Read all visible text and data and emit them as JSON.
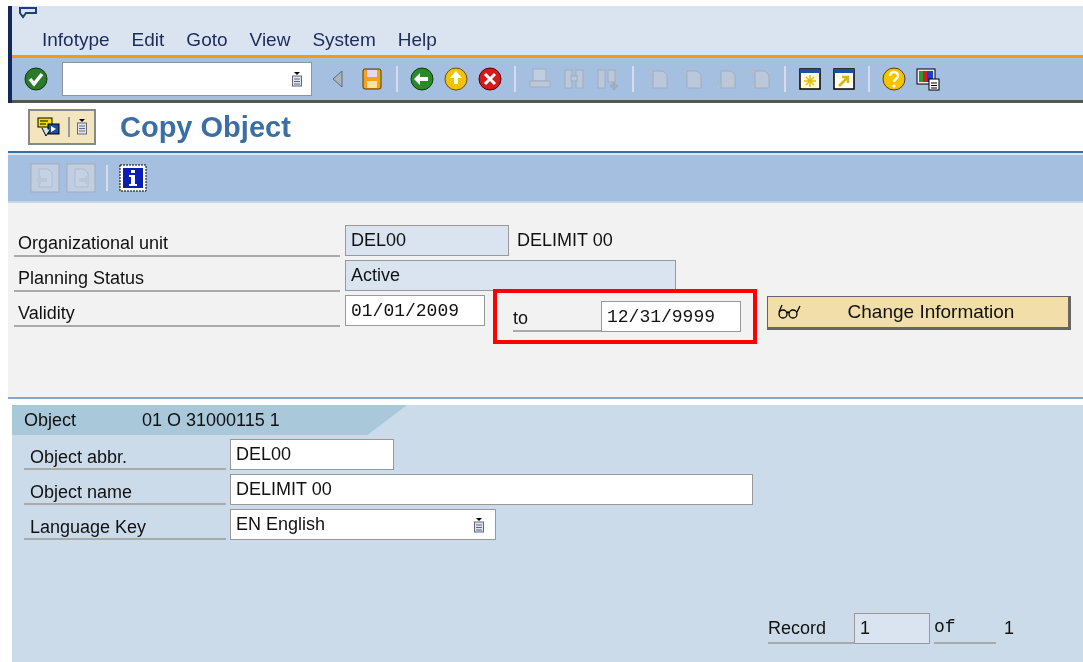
{
  "menu_bar": {
    "items": [
      {
        "label": "Infotype"
      },
      {
        "label": "Edit"
      },
      {
        "label": "Goto"
      },
      {
        "label": "View"
      },
      {
        "label": "System"
      },
      {
        "label": "Help"
      }
    ]
  },
  "standard_toolbar": {
    "items": [
      {
        "kind": "enter",
        "disabled": false
      },
      {
        "kind": "command"
      },
      {
        "kind": "collapse",
        "disabled": false
      },
      {
        "kind": "save",
        "disabled": false
      },
      {
        "kind": "sep"
      },
      {
        "kind": "back",
        "disabled": false
      },
      {
        "kind": "exit",
        "disabled": false
      },
      {
        "kind": "cancel",
        "disabled": false
      },
      {
        "kind": "sep"
      },
      {
        "kind": "print",
        "disabled": true
      },
      {
        "kind": "find",
        "disabled": true
      },
      {
        "kind": "find-next",
        "disabled": true
      },
      {
        "kind": "sep"
      },
      {
        "kind": "first-page",
        "disabled": true
      },
      {
        "kind": "previous-page",
        "disabled": true
      },
      {
        "kind": "next-page",
        "disabled": true
      },
      {
        "kind": "last-page",
        "disabled": true
      },
      {
        "kind": "sep"
      },
      {
        "kind": "new-session",
        "disabled": false
      },
      {
        "kind": "shortcut",
        "disabled": false
      },
      {
        "kind": "sep"
      },
      {
        "kind": "help",
        "disabled": false
      },
      {
        "kind": "layout",
        "disabled": false
      }
    ]
  },
  "title": "Copy Object",
  "app_toolbar": {
    "items": [
      {
        "kind": "previous",
        "disabled": true
      },
      {
        "kind": "next",
        "disabled": true
      },
      {
        "kind": "sep"
      },
      {
        "kind": "info",
        "disabled": false
      }
    ]
  },
  "header_fields": {
    "org_unit": {
      "label": "Organizational unit",
      "value": "DEL00",
      "description": "DELIMIT 00"
    },
    "planning_status": {
      "label": "Planning Status",
      "value": "Active"
    },
    "validity": {
      "label": "Validity",
      "from": "01/01/2009",
      "to_label": "to",
      "to": "12/31/9999",
      "highlighted": true
    },
    "change_button": {
      "label": "Change Information"
    }
  },
  "tab": {
    "label": "Object",
    "key": "01 O  31000115 1",
    "fields": [
      {
        "label": "Object abbr.",
        "value": "DEL00",
        "kind": "short"
      },
      {
        "label": "Object name",
        "value": "DELIMIT 00",
        "kind": "long"
      },
      {
        "label": "Language Key",
        "value": "EN English",
        "kind": "dropdown"
      }
    ],
    "record": {
      "label": "Record",
      "value": "1",
      "of_label": "of",
      "total": "1"
    }
  }
}
